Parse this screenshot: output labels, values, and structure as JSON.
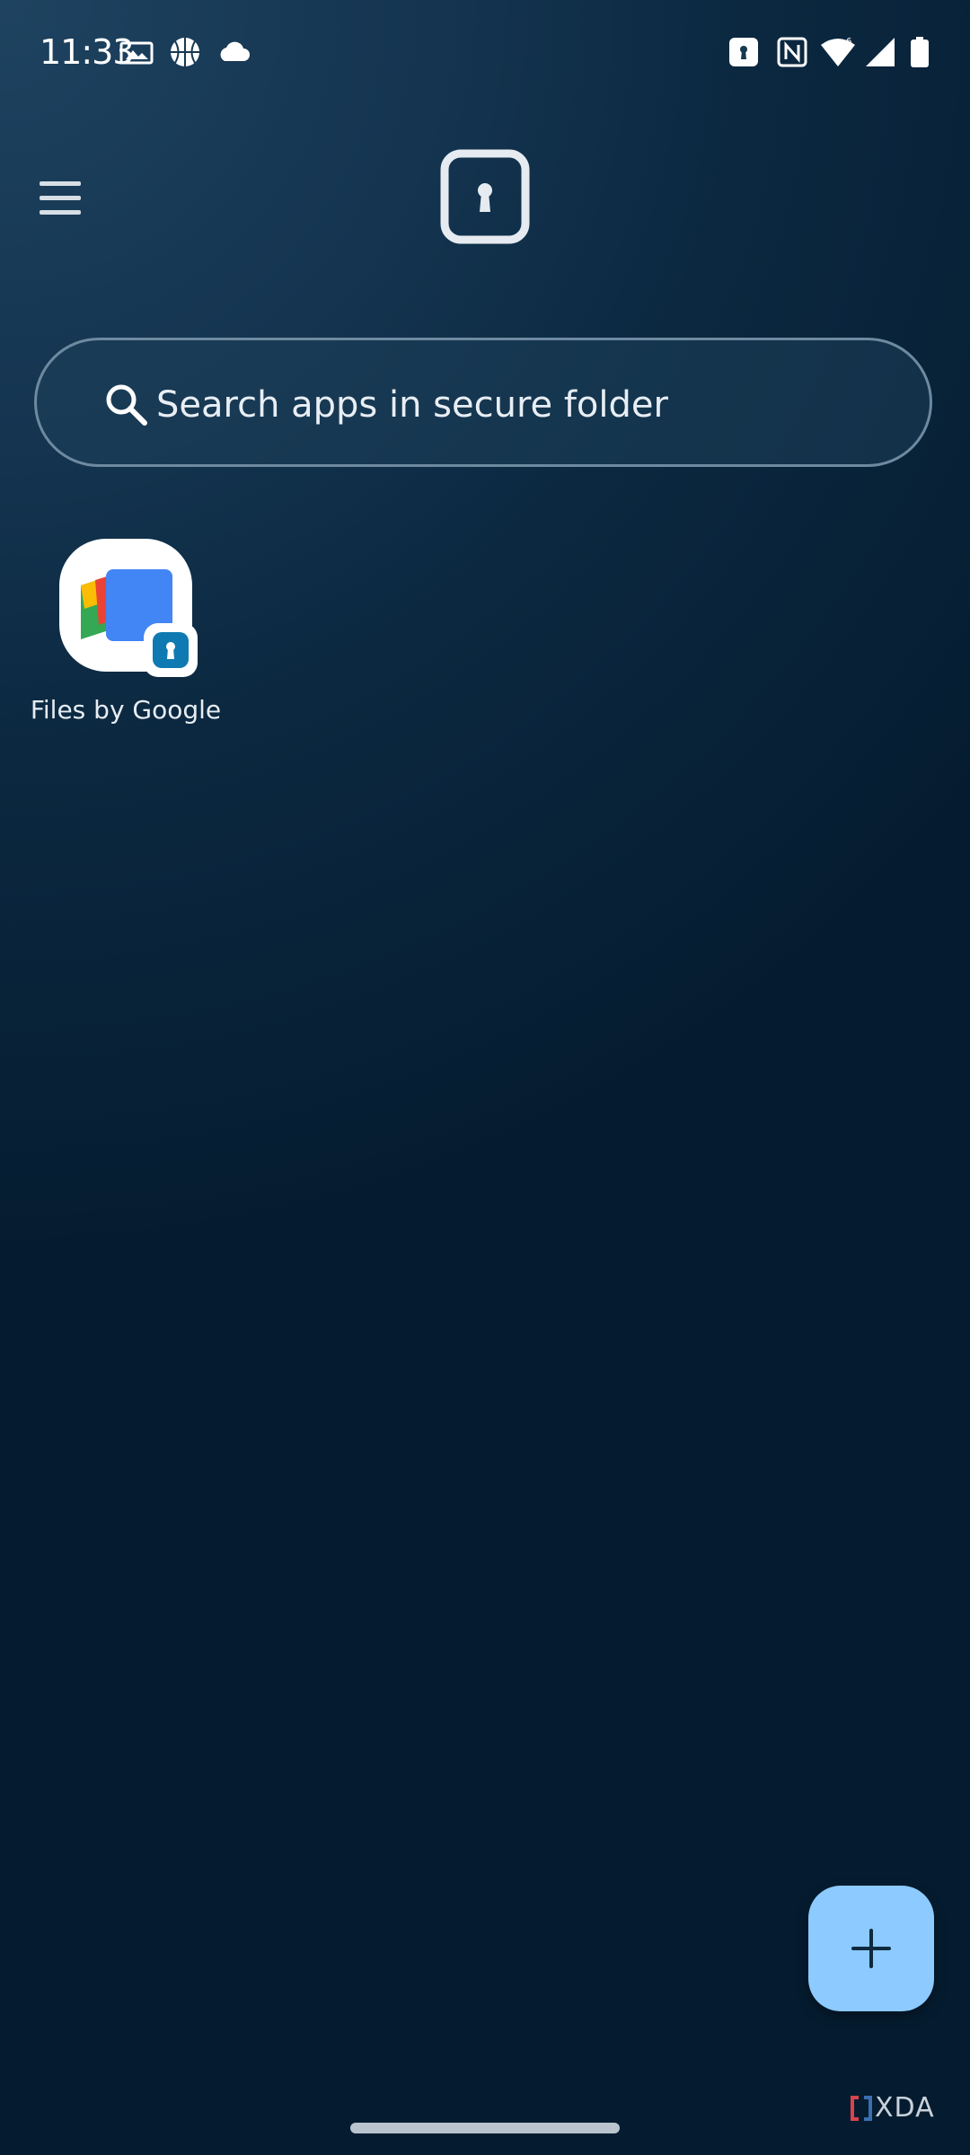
{
  "status_bar": {
    "time": "11:33",
    "left_icons": [
      "picture-icon",
      "basketball-icon",
      "cloud-icon"
    ],
    "right_icons": [
      "secure-folder-icon",
      "nfc-icon",
      "wifi-icon",
      "signal-icon",
      "battery-icon"
    ]
  },
  "header": {
    "menu_icon": "hamburger-menu-icon",
    "logo_icon": "secure-folder-logo-icon"
  },
  "search": {
    "placeholder": "Search apps in secure folder",
    "icon": "search-icon"
  },
  "apps": [
    {
      "label": "Files by Google",
      "icon": "files-by-google-icon",
      "badge": "secure-folder-badge-icon"
    }
  ],
  "fab": {
    "icon": "plus-icon"
  },
  "watermark": {
    "text": "XDA"
  },
  "colors": {
    "background_top": "#1e4360",
    "background_bottom": "#051c30",
    "accent": "#8ccaff",
    "search_border": "#6e8aa0"
  }
}
